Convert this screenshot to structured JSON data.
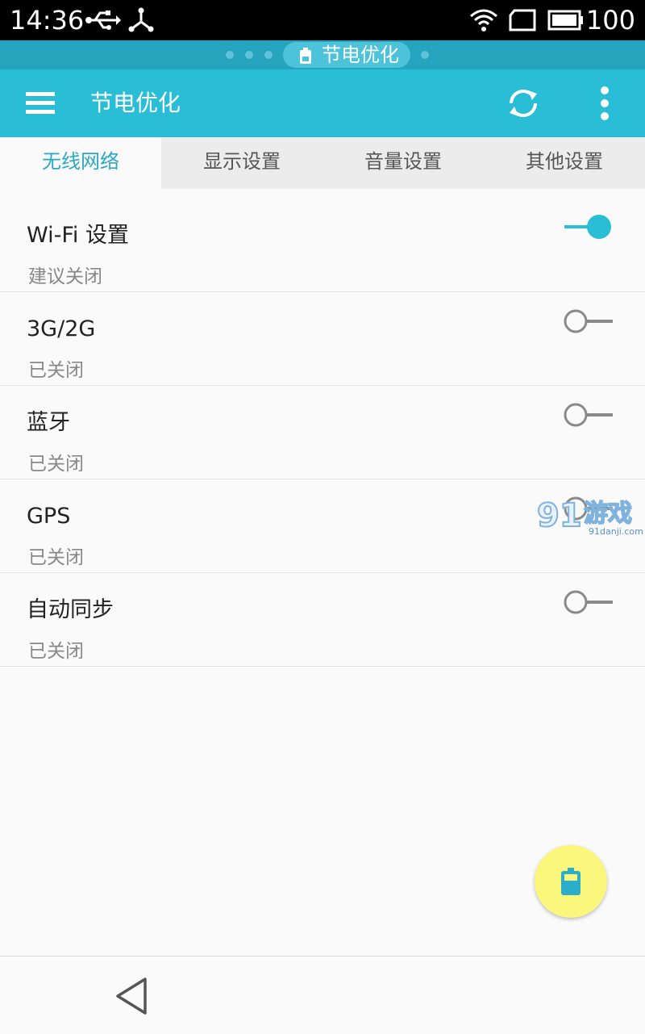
{
  "status_bar": {
    "time": "14:36",
    "icons": [
      "usb-icon",
      "usb-tether-icon",
      "wifi-icon",
      "sim-card-icon",
      "battery-icon"
    ],
    "battery": "100"
  },
  "task_strip": {
    "label": "节电优化",
    "icon": "battery-icon"
  },
  "app_bar": {
    "title": "节电优化",
    "left_icon": "menu-icon",
    "right_icons": [
      "refresh-icon",
      "more-vert-icon"
    ],
    "color": "#2abdd6"
  },
  "tabs": [
    {
      "label": "无线网络",
      "active": true
    },
    {
      "label": "显示设置",
      "active": false
    },
    {
      "label": "音量设置",
      "active": false
    },
    {
      "label": "其他设置",
      "active": false
    }
  ],
  "settings": [
    {
      "title": "Wi-Fi 设置",
      "subtitle": "建议关闭",
      "on": true
    },
    {
      "title": "3G/2G",
      "subtitle": "已关闭",
      "on": false
    },
    {
      "title": "蓝牙",
      "subtitle": "已关闭",
      "on": false
    },
    {
      "title": "GPS",
      "subtitle": "已关闭",
      "on": false
    },
    {
      "title": "自动同步",
      "subtitle": "已关闭",
      "on": false
    }
  ],
  "watermark": {
    "brand": "91游戏",
    "site": "91danji.com"
  },
  "fab": {
    "icon": "battery-icon",
    "color": "#fbf67c"
  },
  "nav_bar": {
    "icon": "back-triangle-icon"
  },
  "colors": {
    "accent": "#2abdd6",
    "toggle_on": "#2abdd6",
    "toggle_off": "#8a8a8a"
  }
}
